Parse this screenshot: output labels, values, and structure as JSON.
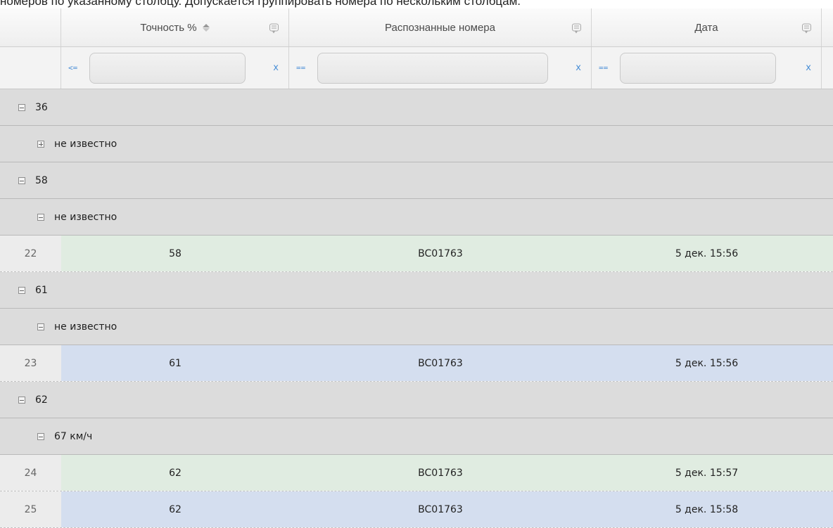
{
  "caption": "номеров по указанному столбцу. Допускается группировать номера по нескольким столбцам.",
  "columns": [
    {
      "title": "Точность %",
      "sorted": "asc"
    },
    {
      "title": "Распознанные номера"
    },
    {
      "title": "Дата"
    }
  ],
  "filters": [
    {
      "op": "<=",
      "value": "",
      "clear": "x"
    },
    {
      "op": "==",
      "value": "",
      "clear": "x"
    },
    {
      "op": "==",
      "value": "",
      "clear": "x"
    }
  ],
  "rows": [
    {
      "type": "group",
      "level": 0,
      "expanded": true,
      "label": "36"
    },
    {
      "type": "group",
      "level": 1,
      "expanded": false,
      "label": "не известно"
    },
    {
      "type": "group",
      "level": 0,
      "expanded": true,
      "label": "58"
    },
    {
      "type": "group",
      "level": 1,
      "expanded": true,
      "label": "не известно"
    },
    {
      "type": "data",
      "num": "22",
      "accuracy": "58",
      "plate": "BC01763",
      "date": "5 дек. 15:56",
      "tint": "green"
    },
    {
      "type": "group",
      "level": 0,
      "expanded": true,
      "label": "61"
    },
    {
      "type": "group",
      "level": 1,
      "expanded": true,
      "label": "не известно"
    },
    {
      "type": "data",
      "num": "23",
      "accuracy": "61",
      "plate": "BC01763",
      "date": "5 дек. 15:56",
      "tint": "blue"
    },
    {
      "type": "group",
      "level": 0,
      "expanded": true,
      "label": "62"
    },
    {
      "type": "group",
      "level": 1,
      "expanded": true,
      "label": "67 км/ч"
    },
    {
      "type": "data",
      "num": "24",
      "accuracy": "62",
      "plate": "BC01763",
      "date": "5 дек. 15:57",
      "tint": "green"
    },
    {
      "type": "data",
      "num": "25",
      "accuracy": "62",
      "plate": "BC01763",
      "date": "5 дек. 15:58",
      "tint": "blue"
    }
  ],
  "colors": {
    "group_bg": "#dcdcdc",
    "row_green": "#e0ece1",
    "row_blue": "#d4deef",
    "filter_op": "#4a8fd6"
  }
}
